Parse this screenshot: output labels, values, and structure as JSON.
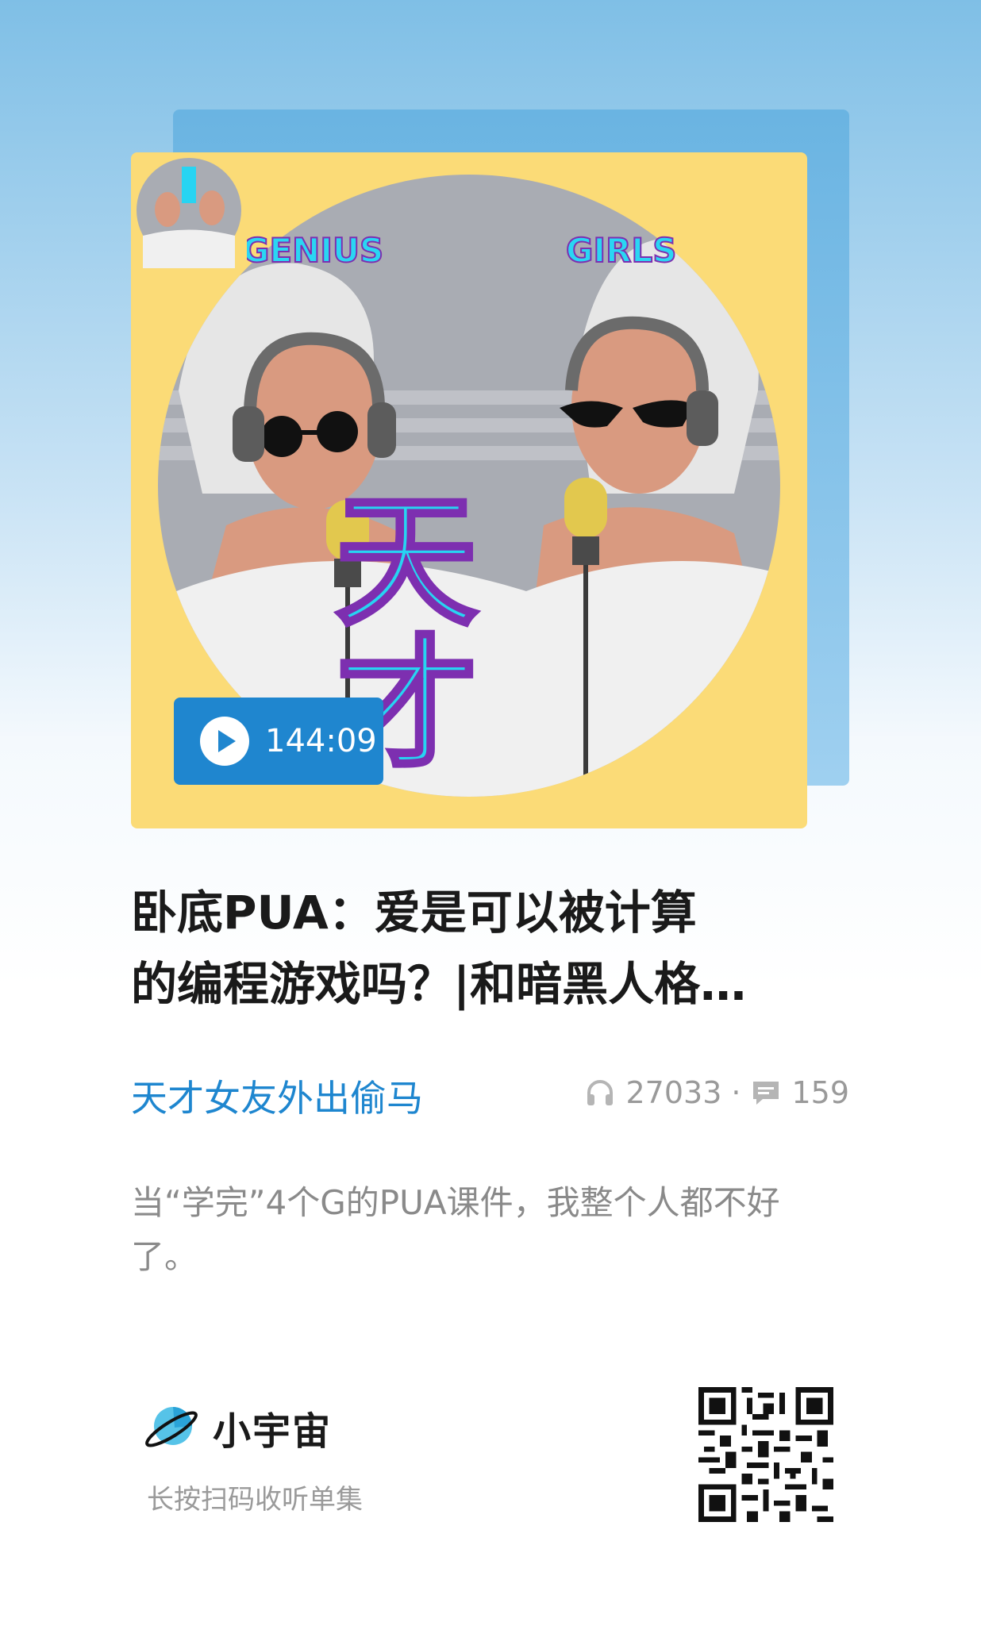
{
  "cover": {
    "art_title": "天才",
    "art_left_word": "GENIUS",
    "art_right_word": "GIRLS",
    "play_icon": "play-icon",
    "duration": "144:09"
  },
  "episode": {
    "title_line1": "卧底PUA：爱是可以被计算",
    "title_line2": "的编程游戏吗？|和暗黑人格…",
    "podcast": "天才女友外出偷马",
    "plays": "27033",
    "dot": "·",
    "comments": "159",
    "description": "当“学完”4个G的PUA课件，我整个人都不好了。"
  },
  "footer": {
    "brand": "小宇宙",
    "scan_hint": "长按扫码收听单集"
  },
  "colors": {
    "accent_blue": "#1f86cf",
    "cover_yellow": "#fbdb77",
    "art_cyan": "#27d4f2",
    "art_purple": "#7d2fb0"
  }
}
